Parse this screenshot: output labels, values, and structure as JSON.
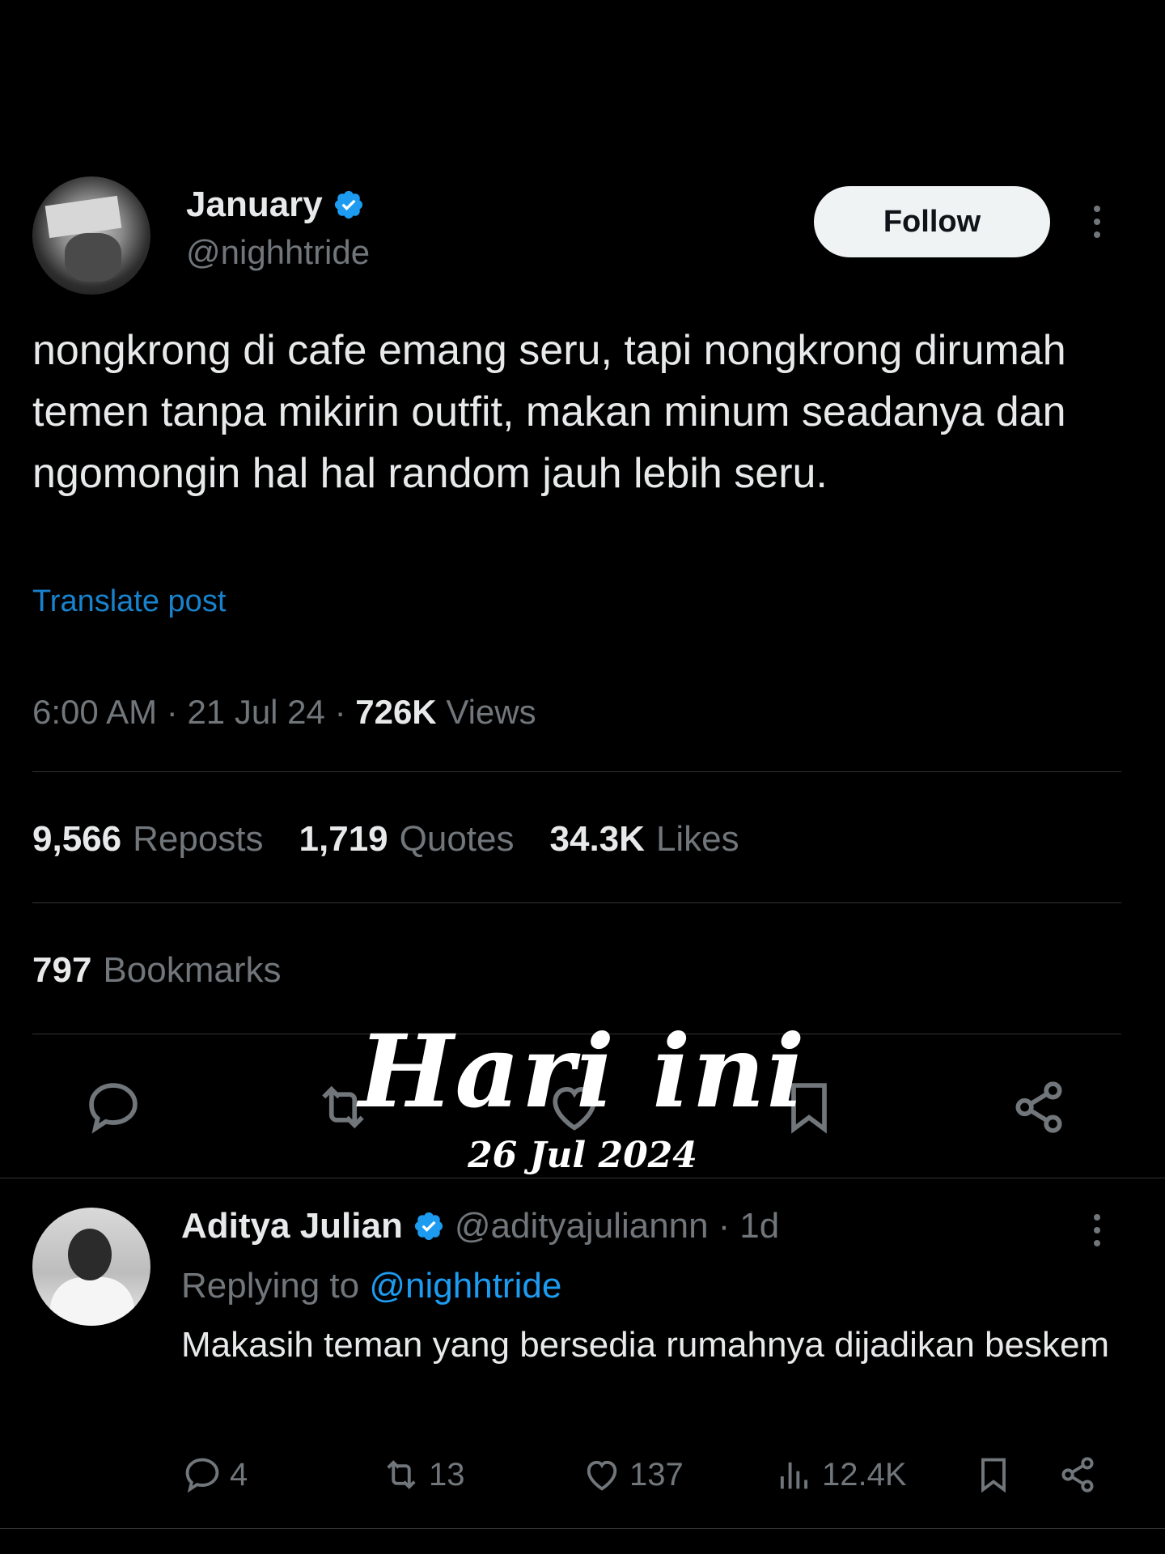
{
  "author": {
    "name": "January",
    "handle": "@nighhtride",
    "follow_label": "Follow"
  },
  "tweet": {
    "text": "nongkrong di cafe emang seru, tapi nongkrong dirumah temen tanpa mikirin outfit, makan minum seadanya dan ngomongin hal hal random jauh lebih seru.",
    "translate_label": "Translate post",
    "time": "6:00 AM",
    "date": "21 Jul 24",
    "views_count": "726K",
    "views_label": "Views"
  },
  "stats": {
    "reposts_count": "9,566",
    "reposts_label": "Reposts",
    "quotes_count": "1,719",
    "quotes_label": "Quotes",
    "likes_count": "34.3K",
    "likes_label": "Likes",
    "bookmarks_count": "797",
    "bookmarks_label": "Bookmarks"
  },
  "overlay": {
    "title": "Hari ini",
    "date": "26 Jul 2024"
  },
  "reply": {
    "name": "Aditya Julian",
    "handle": "@adityajuliannn",
    "age": "1d",
    "replying_prefix": "Replying to",
    "replying_to": "@nighhtride",
    "text": "Makasih teman yang bersedia rumahnya dijadikan beskem",
    "replies": "4",
    "reposts": "13",
    "likes": "137",
    "views": "12.4K"
  },
  "colors": {
    "background": "#000000",
    "text": "#e7e9ea",
    "muted": "#71767b",
    "accent": "#1d9bf0",
    "divider": "#2f3336"
  },
  "icons": [
    "verified-badge-icon",
    "more-icon",
    "reply-icon",
    "repost-icon",
    "like-icon",
    "bookmark-icon",
    "share-icon",
    "views-icon"
  ]
}
